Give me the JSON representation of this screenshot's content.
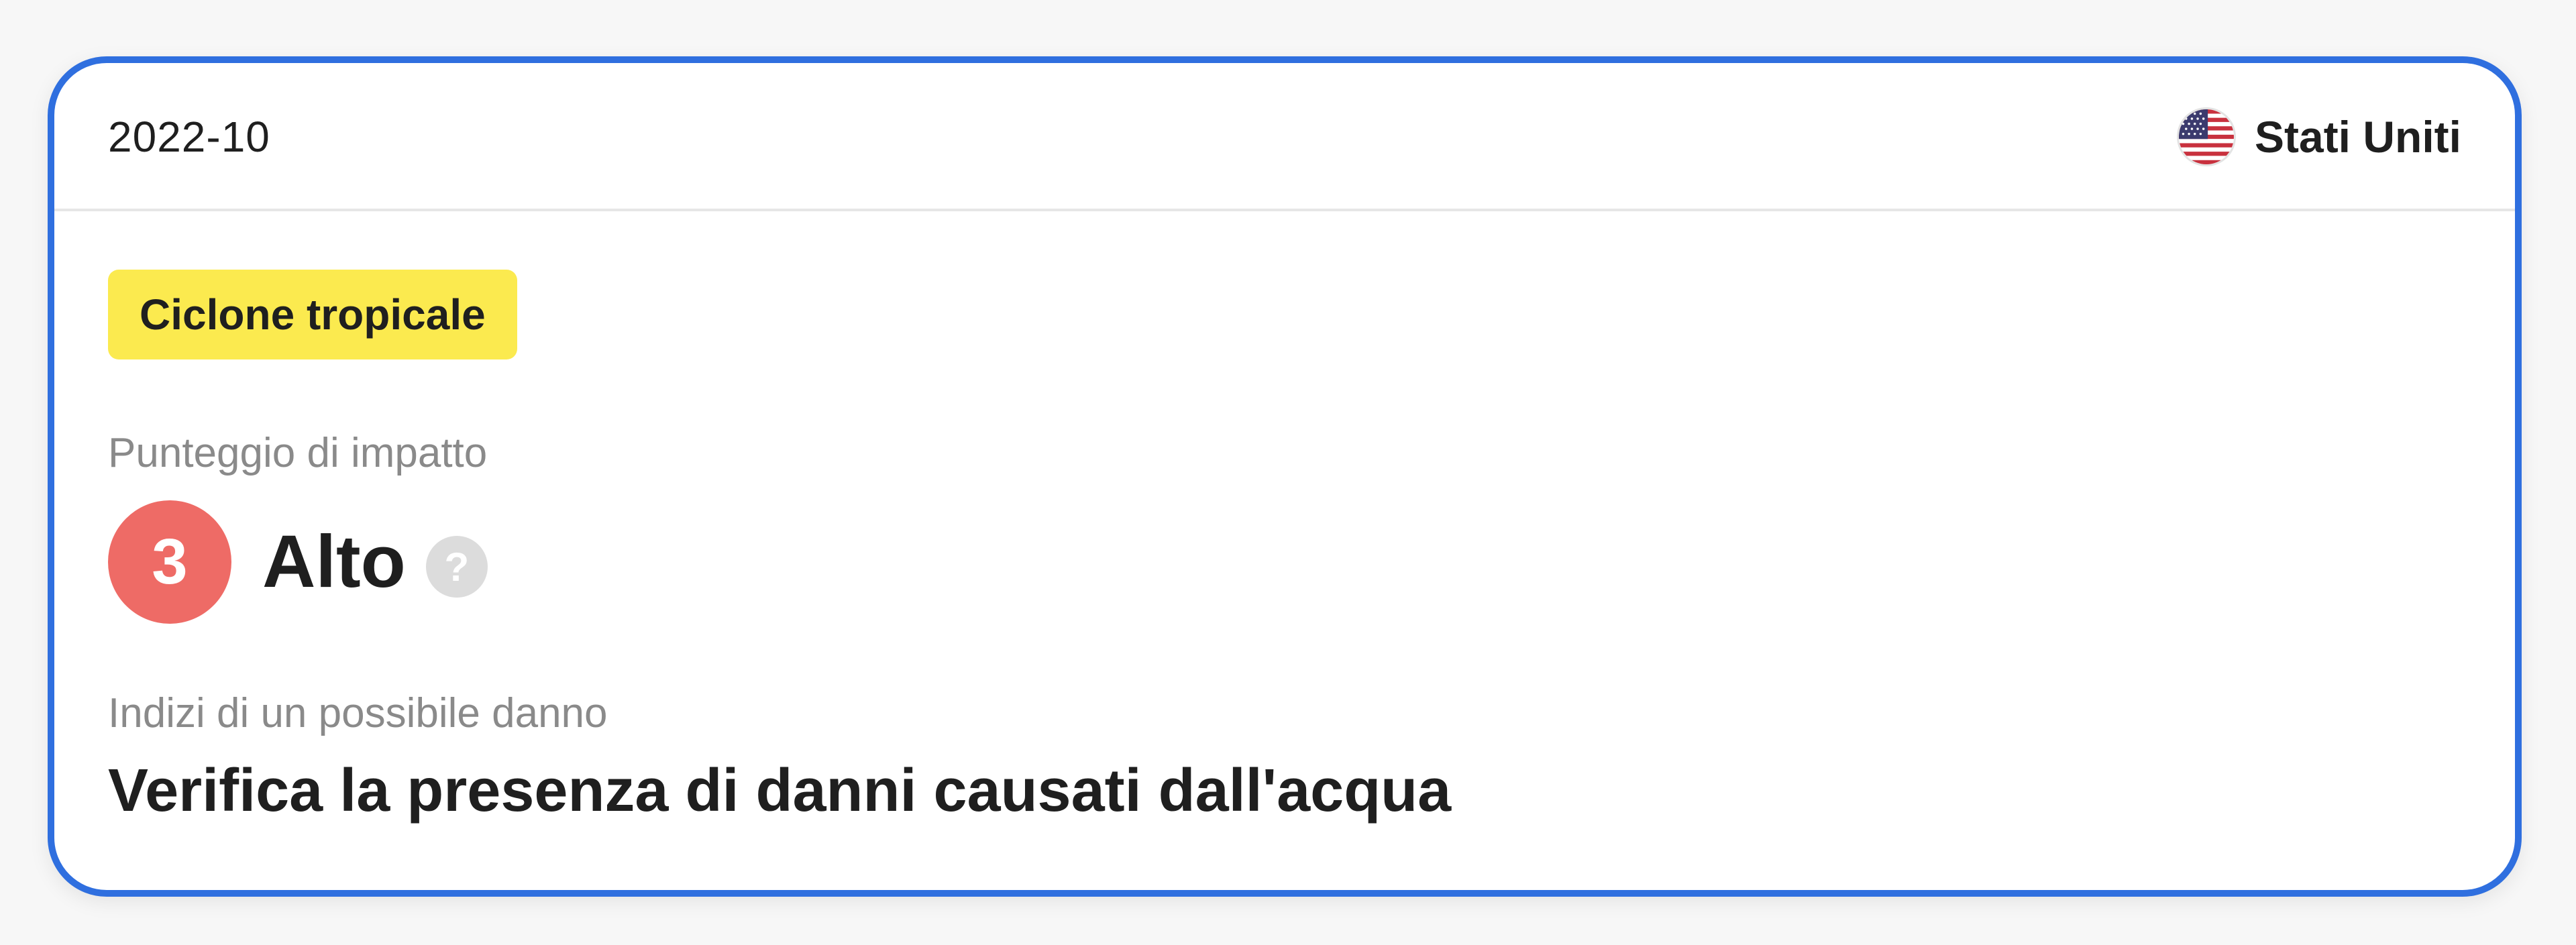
{
  "header": {
    "date": "2022-10",
    "country": {
      "name": "Stati Uniti",
      "flag_icon": "us-flag-icon"
    }
  },
  "event": {
    "type_badge": "Ciclone tropicale",
    "badge_color": "#fbea4f"
  },
  "impact": {
    "label": "Punteggio di impatto",
    "score": "3",
    "level": "Alto",
    "score_color": "#ee6b66",
    "help_icon": "question-mark-icon",
    "help_glyph": "?"
  },
  "damage": {
    "label": "Indizi di un possibile danno",
    "text": "Verifica la presenza di danni causati dall'acqua"
  },
  "accent_color": "#2f6fdf"
}
